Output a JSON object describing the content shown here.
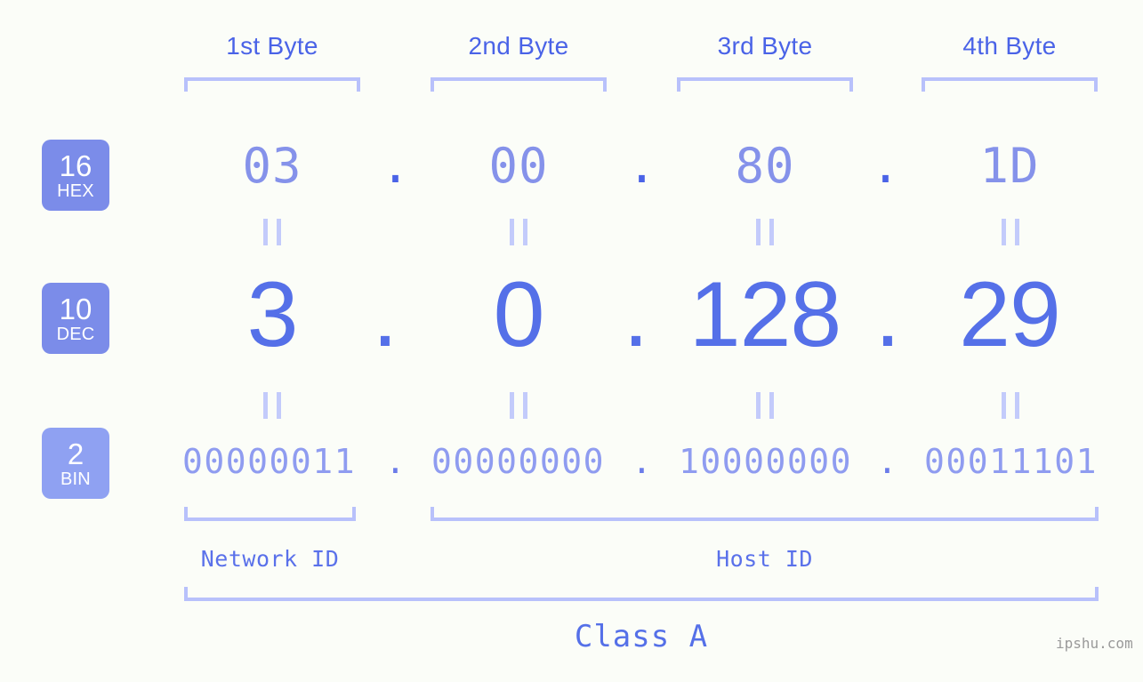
{
  "watermark": "ipshu.com",
  "colors": {
    "background": "#fbfdf8",
    "accent_strong": "#4a63e7",
    "accent_mid": "#5570e8",
    "accent_light": "#8592ea",
    "bracket": "#b8c1fb",
    "badge": "#7b8ce9",
    "badge_bin": "#8fa1f2",
    "watermark": "#9a9a9a"
  },
  "byte_headers": [
    {
      "label": "1st Byte"
    },
    {
      "label": "2nd Byte"
    },
    {
      "label": "3rd Byte"
    },
    {
      "label": "4th Byte"
    }
  ],
  "bases": [
    {
      "number": "16",
      "name": "HEX"
    },
    {
      "number": "10",
      "name": "DEC"
    },
    {
      "number": "2",
      "name": "BIN"
    }
  ],
  "rows": {
    "hex": {
      "base_number": "16",
      "base_name": "HEX",
      "values": [
        "03",
        "00",
        "80",
        "1D"
      ],
      "separator": "."
    },
    "dec": {
      "base_number": "10",
      "base_name": "DEC",
      "values": [
        "3",
        "0",
        "128",
        "29"
      ],
      "separator": "."
    },
    "bin": {
      "base_number": "2",
      "base_name": "BIN",
      "values": [
        "00000011",
        "00000000",
        "10000000",
        "00011101"
      ],
      "separator": "."
    }
  },
  "equals_symbol": "||",
  "sections": [
    {
      "label": "Network ID"
    },
    {
      "label": "Host ID"
    }
  ],
  "class": {
    "label": "Class A"
  }
}
